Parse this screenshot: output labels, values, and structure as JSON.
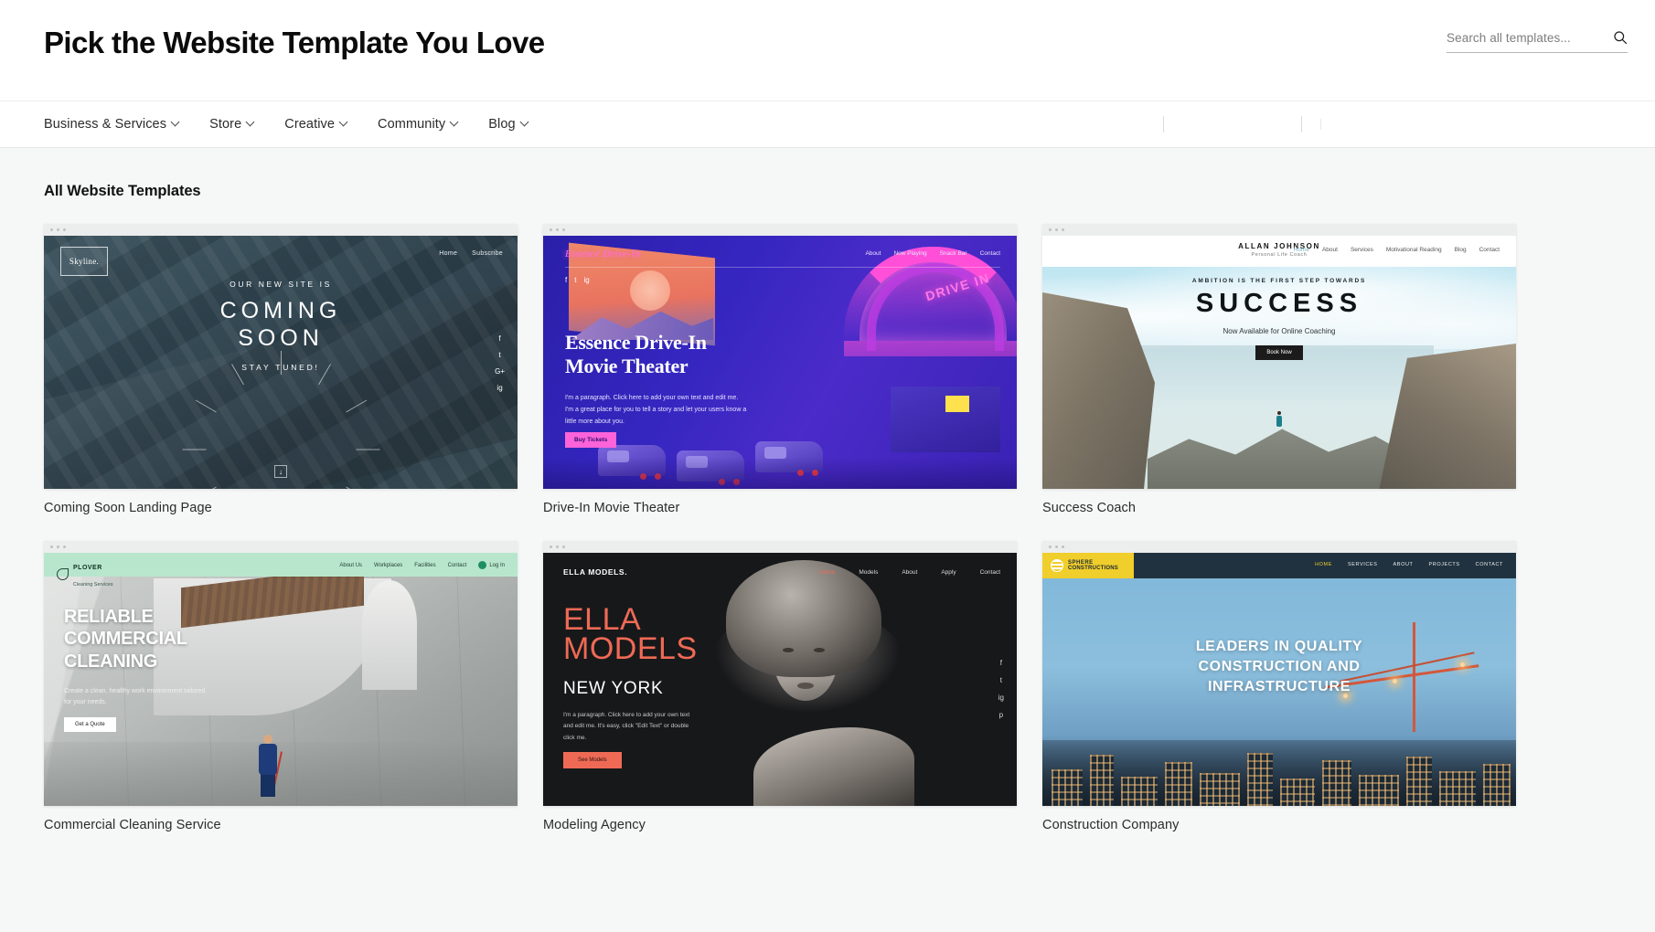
{
  "header": {
    "title": "Pick the Website Template You Love",
    "search": {
      "placeholder": "Search all templates...",
      "value": "",
      "icon": "search-icon"
    }
  },
  "nav": {
    "items": [
      {
        "label": "Business & Services",
        "caret": "chevron-down-icon"
      },
      {
        "label": "Store",
        "caret": "chevron-down-icon"
      },
      {
        "label": "Creative",
        "caret": "chevron-down-icon"
      },
      {
        "label": "Community",
        "caret": "chevron-down-icon"
      },
      {
        "label": "Blog",
        "caret": "chevron-down-icon"
      }
    ]
  },
  "main": {
    "section_title": "All Website Templates",
    "cards": [
      {
        "label": "Coming Soon Landing Page",
        "preview": {
          "logo": "Skyline.",
          "nav": [
            "Home",
            "Subscribe"
          ],
          "pre_headline": "OUR NEW SITE IS",
          "headline_line1": "COMING",
          "headline_line2": "SOON",
          "post_headline": "STAY TUNED!",
          "social": [
            "f",
            "t",
            "G+",
            "ig"
          ],
          "scroll_icon": "arrow-down-icon"
        }
      },
      {
        "label": "Drive-In Movie Theater",
        "preview": {
          "logo": "Essence Drive-In",
          "nav": [
            "About",
            "Now Playing",
            "Snack Bar",
            "Contact"
          ],
          "social": [
            "f",
            "t",
            "ig"
          ],
          "headline_line1": "Essence Drive-In",
          "headline_line2": "Movie Theater",
          "paragraph": "I'm a paragraph. Click here to add your own text and edit me. I'm a great place for you to tell a story and let your users know a little more about you.",
          "button": "Buy Tickets",
          "sign_text": "DRIVE IN"
        }
      },
      {
        "label": "Success Coach",
        "preview": {
          "brand_name": "ALLAN JOHNSON",
          "brand_sub": "Personal Life Coach",
          "nav": [
            "Home",
            "About",
            "Services",
            "Motivational Reading",
            "Blog",
            "Contact"
          ],
          "pre_headline": "AMBITION IS THE FIRST STEP TOWARDS",
          "headline": "SUCCESS",
          "subheadline": "Now Available for Online Coaching",
          "button": "Book Now"
        }
      },
      {
        "label": "Commercial Cleaning Service",
        "preview": {
          "logo_name": "PLOVER",
          "logo_sub": "Cleaning Services",
          "nav": [
            "About Us",
            "Workplaces",
            "Facilities",
            "Contact"
          ],
          "account_label": "Log In",
          "headline_line1": "RELIABLE",
          "headline_line2": "COMMERCIAL",
          "headline_line3": "CLEANING",
          "paragraph": "Create a clean, healthy work environment tailored for your needs.",
          "button": "Get a Quote"
        }
      },
      {
        "label": "Modeling Agency",
        "preview": {
          "logo": "ELLA MODELS.",
          "nav": [
            "Home",
            "Models",
            "About",
            "Apply",
            "Contact"
          ],
          "headline_line1": "ELLA",
          "headline_line2": "MODELS",
          "subheadline": "NEW YORK",
          "paragraph": "I'm a paragraph. Click here to add your own text and edit me. It's easy, click \"Edit Text\" or double click me.",
          "button": "See Models",
          "social": [
            "f",
            "t",
            "ig",
            "p"
          ]
        }
      },
      {
        "label": "Construction Company",
        "preview": {
          "logo_name": "SPHERE",
          "logo_sub": "CONSTRUCTIONS",
          "nav": [
            "HOME",
            "SERVICES",
            "ABOUT",
            "PROJECTS",
            "CONTACT"
          ],
          "headline_line1": "LEADERS IN QUALITY",
          "headline_line2": "CONSTRUCTION AND",
          "headline_line3": "INFRASTRUCTURE"
        }
      }
    ]
  },
  "colors": {
    "page_bg": "#f6f7f7",
    "accent_coral": "#ef6a55",
    "accent_yellow": "#f0ce2b",
    "accent_pink": "#ff63d9",
    "accent_mint": "#b8e6cd"
  }
}
